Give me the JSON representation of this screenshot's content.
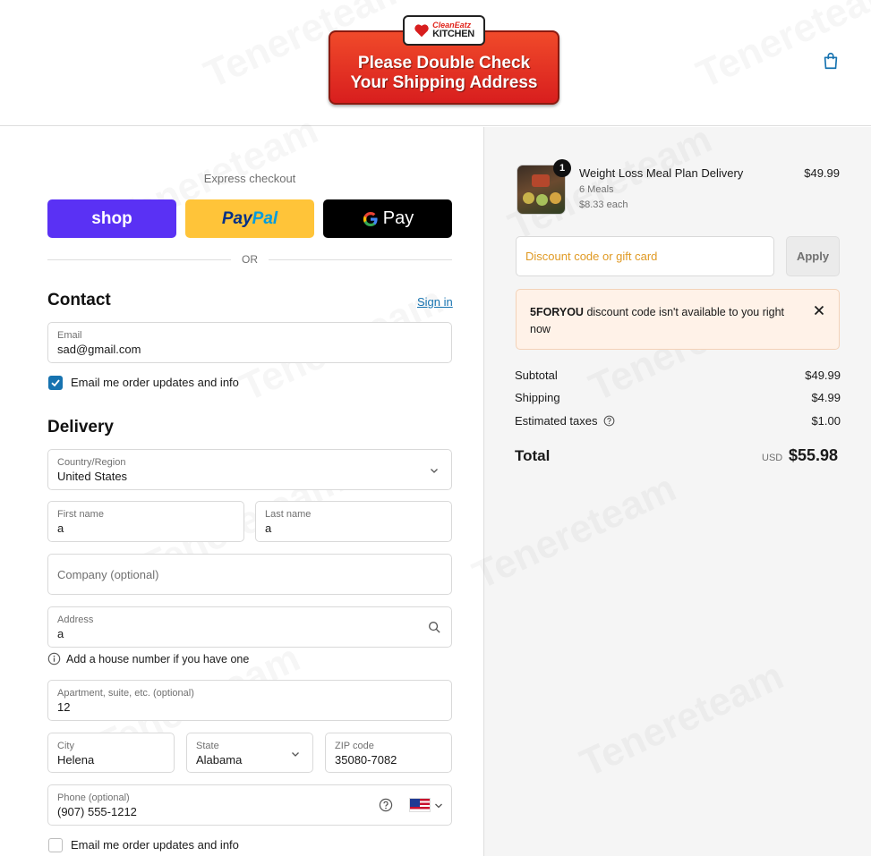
{
  "header": {
    "logo_brand_top": "CleanEatz",
    "logo_brand_bottom": "KITCHEN",
    "logo_line1": "Please Double Check",
    "logo_line2": "Your Shipping Address",
    "cart_icon": "shopping-bag-icon"
  },
  "express": {
    "title": "Express checkout",
    "shop_label": "shop",
    "paypal_label_a": "Pay",
    "paypal_label_b": "Pal",
    "gpay_label": "Pay",
    "or_label": "OR"
  },
  "contact": {
    "title": "Contact",
    "signin_label": "Sign in",
    "email_label": "Email",
    "email_value": "sad@gmail.com",
    "updates_label": "Email me order updates and info",
    "updates_checked": true
  },
  "delivery": {
    "title": "Delivery",
    "country_label": "Country/Region",
    "country_value": "United States",
    "first_name_label": "First name",
    "first_name_value": "a",
    "last_name_label": "Last name",
    "last_name_value": "a",
    "company_placeholder": "Company (optional)",
    "address_label": "Address",
    "address_value": "a",
    "address_hint": "Add a house number if you have one",
    "apartment_label": "Apartment, suite, etc. (optional)",
    "apartment_value": "12",
    "city_label": "City",
    "city_value": "Helena",
    "state_label": "State",
    "state_value": "Alabama",
    "zip_label": "ZIP code",
    "zip_value": "35080-7082",
    "phone_label": "Phone (optional)",
    "phone_value": "(907) 555-1212",
    "updates_label": "Email me order updates and info",
    "updates_checked": false
  },
  "summary": {
    "product": {
      "quantity": "1",
      "name": "Weight Loss Meal Plan Delivery",
      "variant": "6 Meals",
      "unit_price": "$8.33 each",
      "price": "$49.99"
    },
    "discount_placeholder": "Discount code or gift card",
    "apply_label": "Apply",
    "alert_code": "5FORYOU",
    "alert_message": " discount code isn't available to you right now",
    "subtotal_label": "Subtotal",
    "subtotal_value": "$49.99",
    "shipping_label": "Shipping",
    "shipping_value": "$4.99",
    "taxes_label": "Estimated taxes",
    "taxes_value": "$1.00",
    "total_label": "Total",
    "total_currency": "USD",
    "total_value": "$55.98"
  },
  "watermark": "Tenereteam",
  "colors": {
    "shop_pay": "#5a31f4",
    "paypal": "#ffc439",
    "link": "#1773b0",
    "discount_placeholder": "#e09a24",
    "alert_bg": "#fff2e8"
  }
}
